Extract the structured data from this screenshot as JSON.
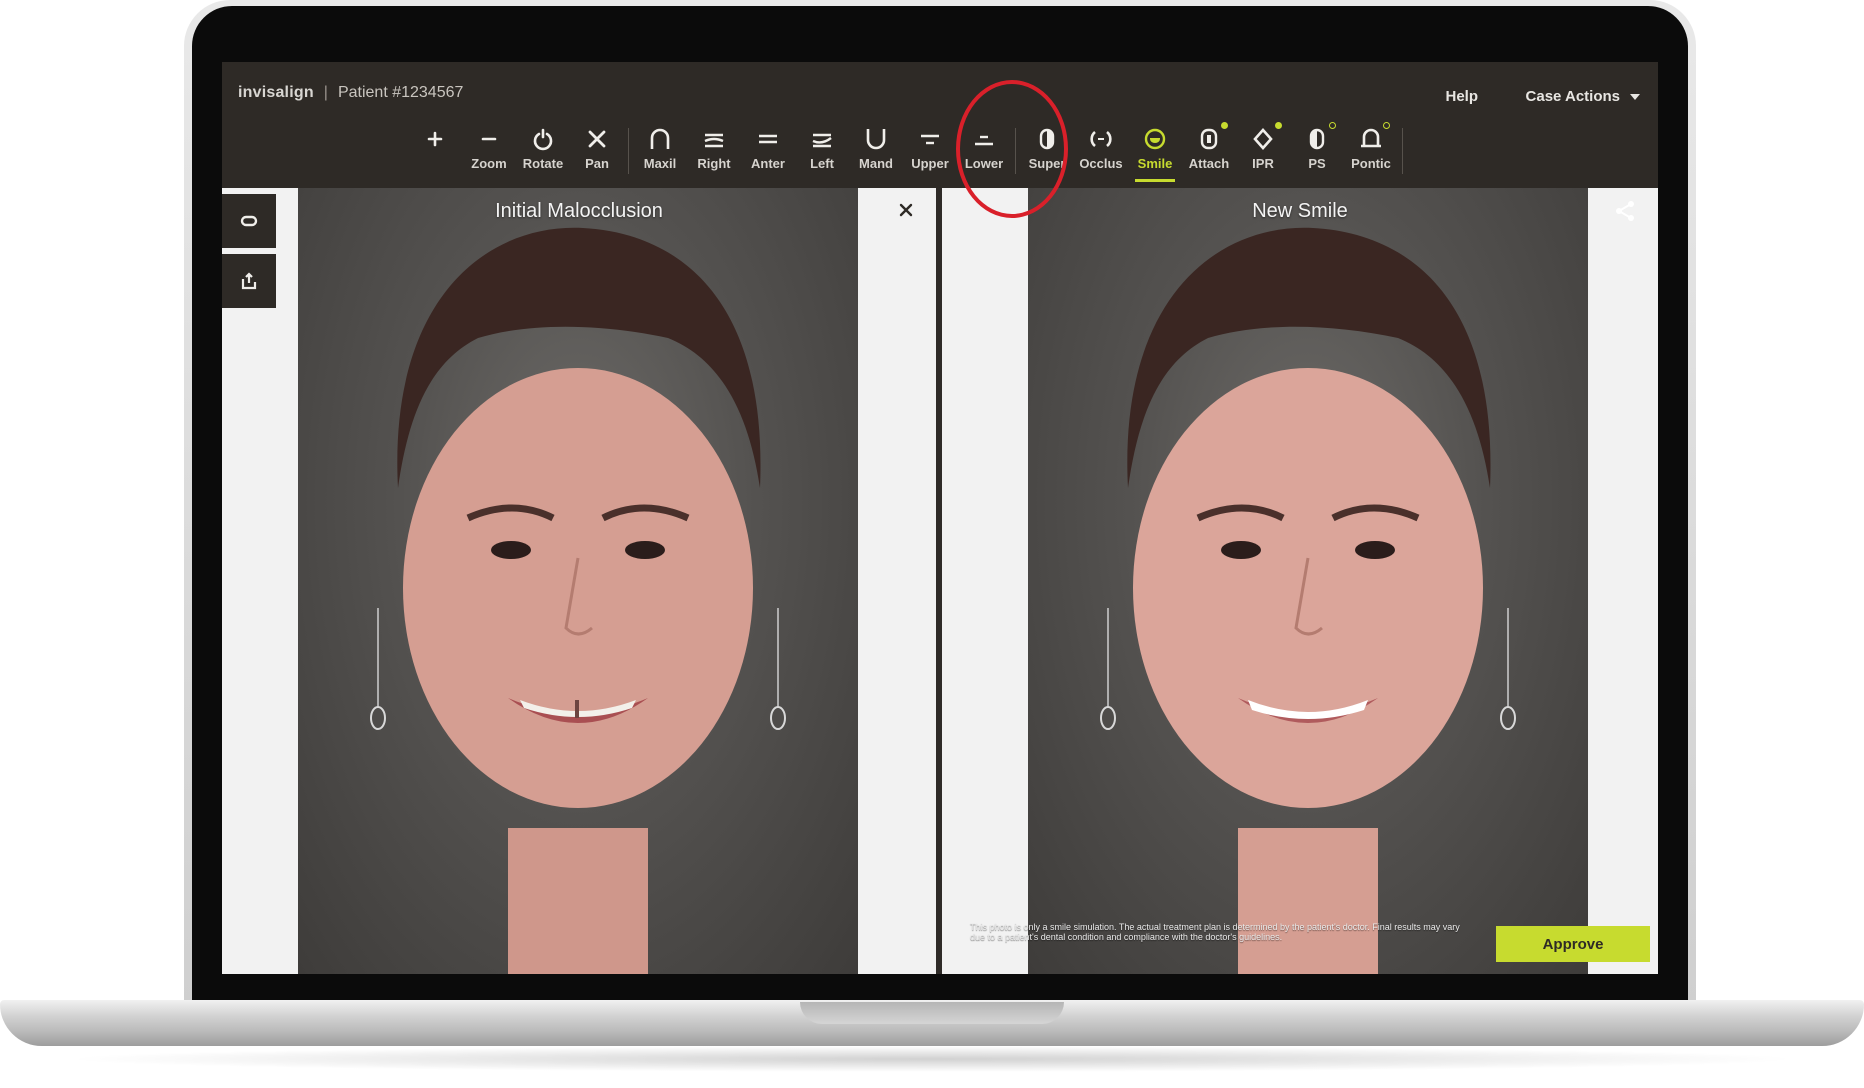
{
  "app": {
    "brand": "invisalign",
    "patient": "Patient #1234567",
    "help": "Help",
    "case_actions": "Case Actions"
  },
  "toolbar": [
    {
      "label": "",
      "icon": "plus-icon"
    },
    {
      "label": "Zoom",
      "icon": "minus-icon"
    },
    {
      "label": "Rotate",
      "icon": "rotate-icon"
    },
    {
      "label": "Pan",
      "icon": "pan-icon"
    },
    {
      "label": "Maxil",
      "icon": "maxillary-arch-icon"
    },
    {
      "label": "Right",
      "icon": "right-view-icon"
    },
    {
      "label": "Anter",
      "icon": "anterior-view-icon"
    },
    {
      "label": "Left",
      "icon": "left-view-icon"
    },
    {
      "label": "Mand",
      "icon": "mandibular-arch-icon"
    },
    {
      "label": "Upper",
      "icon": "upper-jaw-icon"
    },
    {
      "label": "Lower",
      "icon": "lower-jaw-icon"
    },
    {
      "label": "Super",
      "icon": "superimpose-icon"
    },
    {
      "label": "Occlus",
      "icon": "occlusion-icon"
    },
    {
      "label": "Smile",
      "icon": "smile-icon",
      "active": true
    },
    {
      "label": "Attach",
      "icon": "attachment-icon"
    },
    {
      "label": "IPR",
      "icon": "ipr-icon"
    },
    {
      "label": "PS",
      "icon": "ps-icon"
    },
    {
      "label": "Pontic",
      "icon": "pontic-icon"
    }
  ],
  "panels": {
    "left": {
      "title": "Initial Malocclusion"
    },
    "right": {
      "title": "New Smile",
      "disclaimer": "This photo is only a smile simulation. The actual treatment plan is determined by the patient's doctor. Final results may vary due to a patient's dental condition and compliance with the doctor's guidelines.",
      "approve": "Approve"
    }
  },
  "colors": {
    "accent": "#c7db2f",
    "toolbar_bg": "#2e2a26",
    "highlight_ring": "#d9202a"
  }
}
